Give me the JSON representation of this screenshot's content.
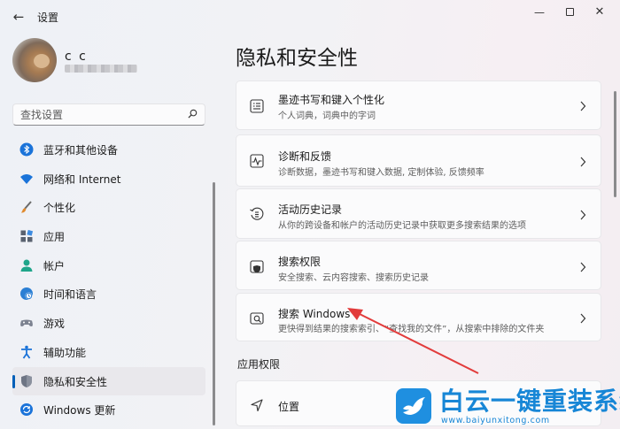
{
  "window": {
    "title": "设置",
    "controls": [
      "minimize",
      "maximize",
      "close"
    ]
  },
  "user": {
    "name": "c c",
    "email_obscured": true
  },
  "search": {
    "placeholder": "查找设置"
  },
  "sidebar": {
    "items": [
      {
        "label": "蓝牙和其他设备",
        "icon": "bluetooth-icon",
        "active": false
      },
      {
        "label": "网络和 Internet",
        "icon": "wifi-icon",
        "active": false
      },
      {
        "label": "个性化",
        "icon": "brush-icon",
        "active": false
      },
      {
        "label": "应用",
        "icon": "apps-icon",
        "active": false
      },
      {
        "label": "帐户",
        "icon": "account-icon",
        "active": false
      },
      {
        "label": "时间和语言",
        "icon": "globe-clock-icon",
        "active": false
      },
      {
        "label": "游戏",
        "icon": "gamepad-icon",
        "active": false
      },
      {
        "label": "辅助功能",
        "icon": "accessibility-icon",
        "active": false
      },
      {
        "label": "隐私和安全性",
        "icon": "shield-icon",
        "active": true
      },
      {
        "label": "Windows 更新",
        "icon": "update-icon",
        "active": false
      }
    ]
  },
  "main": {
    "title": "隐私和安全性",
    "cards": [
      {
        "title": "墨迹书写和键入个性化",
        "desc": "个人词典，词典中的字词",
        "icon": "notebook-icon"
      },
      {
        "title": "诊断和反馈",
        "desc": "诊断数据，墨迹书写和键入数据, 定制体验, 反馈频率",
        "icon": "diagnostics-icon"
      },
      {
        "title": "活动历史记录",
        "desc": "从你的跨设备和帐户的活动历史记录中获取更多搜索结果的选项",
        "icon": "history-icon"
      },
      {
        "title": "搜索权限",
        "desc": "安全搜索、云内容搜索、搜索历史记录",
        "icon": "search-shield-icon"
      },
      {
        "title": "搜索 Windows",
        "desc": "更快得到结果的搜索索引、“查找我的文件”，从搜索中排除的文件夹",
        "icon": "search-windows-icon"
      }
    ],
    "section_header": "应用权限",
    "location_card": {
      "title": "位置",
      "icon": "location-icon"
    }
  },
  "watermark": {
    "title": "白云一键重装系统",
    "url": "www.baiyunxitong.com"
  },
  "colors": {
    "accent": "#005fb8",
    "annotation_arrow": "#e23b3b",
    "watermark": "#1786d6"
  }
}
